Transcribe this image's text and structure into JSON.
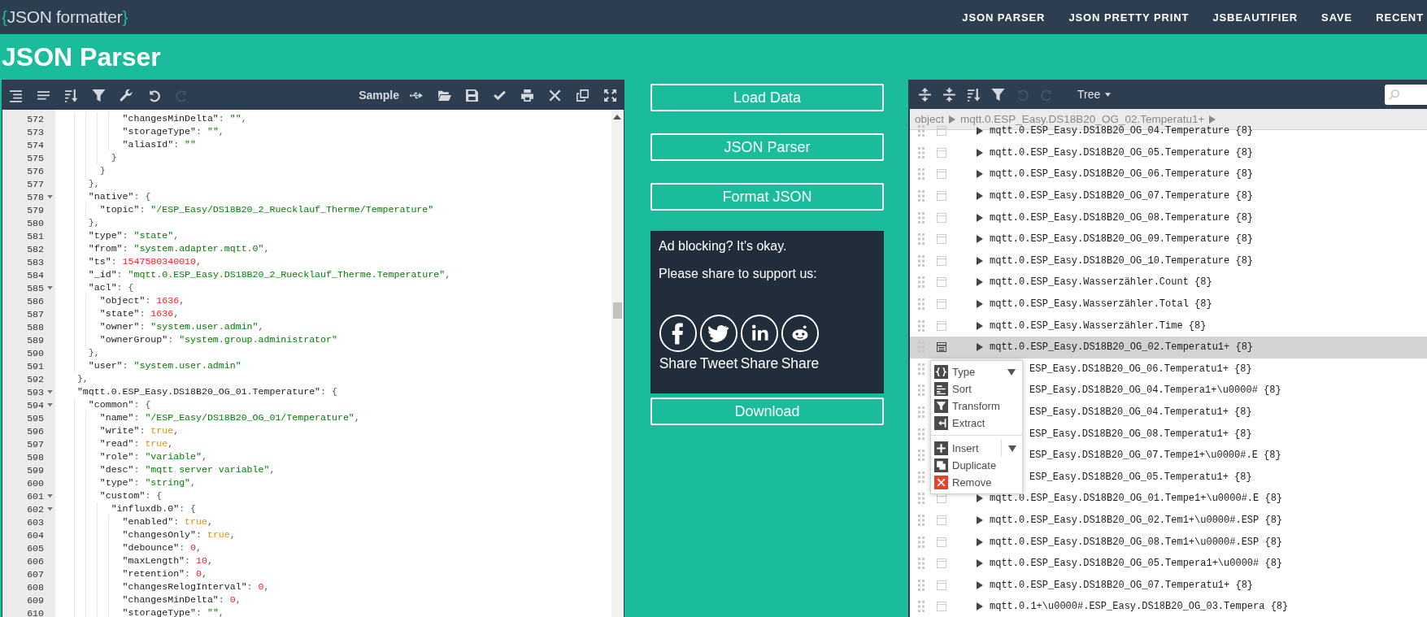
{
  "nav": {
    "logo": {
      "open": "{",
      "name": "JSON formatter",
      "close": "}"
    },
    "links": [
      "JSON PARSER",
      "JSON PRETTY PRINT",
      "JSBEAUTIFIER",
      "SAVE",
      "RECENT"
    ]
  },
  "page_title": "JSON Parser",
  "code_editor": {
    "tools": [
      {
        "kind": "format",
        "disabled": false
      },
      {
        "kind": "compact",
        "disabled": false
      },
      {
        "kind": "sort",
        "disabled": false
      },
      {
        "kind": "filter",
        "disabled": false
      },
      {
        "kind": "repair",
        "disabled": false
      },
      {
        "kind": "undo",
        "disabled": false
      },
      {
        "kind": "redo",
        "disabled": true
      }
    ],
    "sample_button": "Sample",
    "file_tools": [
      {
        "kind": "usb"
      },
      {
        "kind": "open"
      },
      {
        "kind": "save"
      },
      {
        "kind": "validate"
      },
      {
        "kind": "print"
      },
      {
        "kind": "clear"
      },
      {
        "kind": "copy"
      },
      {
        "kind": "fullscreen"
      }
    ],
    "lines": [
      {
        "number": "572",
        "fold": false,
        "tokens": [
          {
            "kind": "key",
            "text": "          \"changesMinDelta\""
          },
          {
            "kind": "punct",
            "text": ": "
          },
          {
            "kind": "str",
            "text": "\"\""
          },
          {
            "kind": "punct",
            "text": ","
          }
        ]
      },
      {
        "number": "573",
        "fold": false,
        "tokens": [
          {
            "kind": "key",
            "text": "          \"storageType\""
          },
          {
            "kind": "punct",
            "text": ": "
          },
          {
            "kind": "str",
            "text": "\"\""
          },
          {
            "kind": "punct",
            "text": ","
          }
        ]
      },
      {
        "number": "574",
        "fold": false,
        "tokens": [
          {
            "kind": "key",
            "text": "          \"aliasId\""
          },
          {
            "kind": "punct",
            "text": ": "
          },
          {
            "kind": "str",
            "text": "\"\""
          }
        ]
      },
      {
        "number": "575",
        "fold": false,
        "tokens": [
          {
            "kind": "punct",
            "text": "        }"
          }
        ]
      },
      {
        "number": "576",
        "fold": false,
        "tokens": [
          {
            "kind": "punct",
            "text": "      }"
          }
        ]
      },
      {
        "number": "577",
        "fold": false,
        "tokens": [
          {
            "kind": "punct",
            "text": "    },"
          }
        ]
      },
      {
        "number": "578",
        "fold": true,
        "tokens": [
          {
            "kind": "key",
            "text": "    \"native\""
          },
          {
            "kind": "punct",
            "text": ": {"
          }
        ]
      },
      {
        "number": "579",
        "fold": false,
        "tokens": [
          {
            "kind": "key",
            "text": "      \"topic\""
          },
          {
            "kind": "punct",
            "text": ": "
          },
          {
            "kind": "str",
            "text": "\"/ESP_Easy/DS18B20_2_Ruecklauf_Therme/Temperature\""
          }
        ]
      },
      {
        "number": "580",
        "fold": false,
        "tokens": [
          {
            "kind": "punct",
            "text": "    },"
          }
        ]
      },
      {
        "number": "581",
        "fold": false,
        "tokens": [
          {
            "kind": "key",
            "text": "    \"type\""
          },
          {
            "kind": "punct",
            "text": ": "
          },
          {
            "kind": "str",
            "text": "\"state\""
          },
          {
            "kind": "punct",
            "text": ","
          }
        ]
      },
      {
        "number": "582",
        "fold": false,
        "tokens": [
          {
            "kind": "key",
            "text": "    \"from\""
          },
          {
            "kind": "punct",
            "text": ": "
          },
          {
            "kind": "str",
            "text": "\"system.adapter.mqtt.0\""
          },
          {
            "kind": "punct",
            "text": ","
          }
        ]
      },
      {
        "number": "583",
        "fold": false,
        "tokens": [
          {
            "kind": "key",
            "text": "    \"ts\""
          },
          {
            "kind": "punct",
            "text": ": "
          },
          {
            "kind": "num",
            "text": "1547580340010"
          },
          {
            "kind": "punct",
            "text": ","
          }
        ]
      },
      {
        "number": "584",
        "fold": false,
        "tokens": [
          {
            "kind": "key",
            "text": "    \"_id\""
          },
          {
            "kind": "punct",
            "text": ": "
          },
          {
            "kind": "str",
            "text": "\"mqtt.0.ESP_Easy.DS18B20_2_Ruecklauf_Therme.Temperature\""
          },
          {
            "kind": "punct",
            "text": ","
          }
        ]
      },
      {
        "number": "585",
        "fold": true,
        "tokens": [
          {
            "kind": "key",
            "text": "    \"acl\""
          },
          {
            "kind": "punct",
            "text": ": {"
          }
        ]
      },
      {
        "number": "586",
        "fold": false,
        "tokens": [
          {
            "kind": "key",
            "text": "      \"object\""
          },
          {
            "kind": "punct",
            "text": ": "
          },
          {
            "kind": "num",
            "text": "1636"
          },
          {
            "kind": "punct",
            "text": ","
          }
        ]
      },
      {
        "number": "587",
        "fold": false,
        "tokens": [
          {
            "kind": "key",
            "text": "      \"state\""
          },
          {
            "kind": "punct",
            "text": ": "
          },
          {
            "kind": "num",
            "text": "1636"
          },
          {
            "kind": "punct",
            "text": ","
          }
        ]
      },
      {
        "number": "588",
        "fold": false,
        "tokens": [
          {
            "kind": "key",
            "text": "      \"owner\""
          },
          {
            "kind": "punct",
            "text": ": "
          },
          {
            "kind": "str",
            "text": "\"system.user.admin\""
          },
          {
            "kind": "punct",
            "text": ","
          }
        ]
      },
      {
        "number": "589",
        "fold": false,
        "tokens": [
          {
            "kind": "key",
            "text": "      \"ownerGroup\""
          },
          {
            "kind": "punct",
            "text": ": "
          },
          {
            "kind": "str",
            "text": "\"system.group.administrator\""
          }
        ]
      },
      {
        "number": "590",
        "fold": false,
        "tokens": [
          {
            "kind": "punct",
            "text": "    },"
          }
        ]
      },
      {
        "number": "591",
        "fold": false,
        "tokens": [
          {
            "kind": "key",
            "text": "    \"user\""
          },
          {
            "kind": "punct",
            "text": ": "
          },
          {
            "kind": "str",
            "text": "\"system.user.admin\""
          }
        ]
      },
      {
        "number": "592",
        "fold": false,
        "tokens": [
          {
            "kind": "punct",
            "text": "  },"
          }
        ]
      },
      {
        "number": "593",
        "fold": true,
        "tokens": [
          {
            "kind": "key",
            "text": "  \"mqtt.0.ESP_Easy.DS18B20_OG_01.Temperature\""
          },
          {
            "kind": "punct",
            "text": ": {"
          }
        ]
      },
      {
        "number": "594",
        "fold": true,
        "tokens": [
          {
            "kind": "key",
            "text": "    \"common\""
          },
          {
            "kind": "punct",
            "text": ": {"
          }
        ]
      },
      {
        "number": "595",
        "fold": false,
        "tokens": [
          {
            "kind": "key",
            "text": "      \"name\""
          },
          {
            "kind": "punct",
            "text": ": "
          },
          {
            "kind": "str",
            "text": "\"/ESP_Easy/DS18B20_OG_01/Temperature\""
          },
          {
            "kind": "punct",
            "text": ","
          }
        ]
      },
      {
        "number": "596",
        "fold": false,
        "tokens": [
          {
            "kind": "key",
            "text": "      \"write\""
          },
          {
            "kind": "punct",
            "text": ": "
          },
          {
            "kind": "bool",
            "text": "true"
          },
          {
            "kind": "punct",
            "text": ","
          }
        ]
      },
      {
        "number": "597",
        "fold": false,
        "tokens": [
          {
            "kind": "key",
            "text": "      \"read\""
          },
          {
            "kind": "punct",
            "text": ": "
          },
          {
            "kind": "bool",
            "text": "true"
          },
          {
            "kind": "punct",
            "text": ","
          }
        ]
      },
      {
        "number": "598",
        "fold": false,
        "tokens": [
          {
            "kind": "key",
            "text": "      \"role\""
          },
          {
            "kind": "punct",
            "text": ": "
          },
          {
            "kind": "str",
            "text": "\"variable\""
          },
          {
            "kind": "punct",
            "text": ","
          }
        ]
      },
      {
        "number": "599",
        "fold": false,
        "tokens": [
          {
            "kind": "key",
            "text": "      \"desc\""
          },
          {
            "kind": "punct",
            "text": ": "
          },
          {
            "kind": "str",
            "text": "\"mqtt server variable\""
          },
          {
            "kind": "punct",
            "text": ","
          }
        ]
      },
      {
        "number": "600",
        "fold": false,
        "tokens": [
          {
            "kind": "key",
            "text": "      \"type\""
          },
          {
            "kind": "punct",
            "text": ": "
          },
          {
            "kind": "str",
            "text": "\"string\""
          },
          {
            "kind": "punct",
            "text": ","
          }
        ]
      },
      {
        "number": "601",
        "fold": true,
        "tokens": [
          {
            "kind": "key",
            "text": "      \"custom\""
          },
          {
            "kind": "punct",
            "text": ": {"
          }
        ]
      },
      {
        "number": "602",
        "fold": true,
        "tokens": [
          {
            "kind": "key",
            "text": "        \"influxdb.0\""
          },
          {
            "kind": "punct",
            "text": ": {"
          }
        ]
      },
      {
        "number": "603",
        "fold": false,
        "tokens": [
          {
            "kind": "key",
            "text": "          \"enabled\""
          },
          {
            "kind": "punct",
            "text": ": "
          },
          {
            "kind": "bool",
            "text": "true"
          },
          {
            "kind": "punct",
            "text": ","
          }
        ]
      },
      {
        "number": "604",
        "fold": false,
        "tokens": [
          {
            "kind": "key",
            "text": "          \"changesOnly\""
          },
          {
            "kind": "punct",
            "text": ": "
          },
          {
            "kind": "bool",
            "text": "true"
          },
          {
            "kind": "punct",
            "text": ","
          }
        ]
      },
      {
        "number": "605",
        "fold": false,
        "tokens": [
          {
            "kind": "key",
            "text": "          \"debounce\""
          },
          {
            "kind": "punct",
            "text": ": "
          },
          {
            "kind": "num",
            "text": "0"
          },
          {
            "kind": "punct",
            "text": ","
          }
        ]
      },
      {
        "number": "606",
        "fold": false,
        "tokens": [
          {
            "kind": "key",
            "text": "          \"maxLength\""
          },
          {
            "kind": "punct",
            "text": ": "
          },
          {
            "kind": "num",
            "text": "10"
          },
          {
            "kind": "punct",
            "text": ","
          }
        ]
      },
      {
        "number": "607",
        "fold": false,
        "tokens": [
          {
            "kind": "key",
            "text": "          \"retention\""
          },
          {
            "kind": "punct",
            "text": ": "
          },
          {
            "kind": "num",
            "text": "0"
          },
          {
            "kind": "punct",
            "text": ","
          }
        ]
      },
      {
        "number": "608",
        "fold": false,
        "tokens": [
          {
            "kind": "key",
            "text": "          \"changesRelogInterval\""
          },
          {
            "kind": "punct",
            "text": ": "
          },
          {
            "kind": "num",
            "text": "0"
          },
          {
            "kind": "punct",
            "text": ","
          }
        ]
      },
      {
        "number": "609",
        "fold": false,
        "tokens": [
          {
            "kind": "key",
            "text": "          \"changesMinDelta\""
          },
          {
            "kind": "punct",
            "text": ": "
          },
          {
            "kind": "num",
            "text": "0"
          },
          {
            "kind": "punct",
            "text": ","
          }
        ]
      },
      {
        "number": "610",
        "fold": false,
        "tokens": [
          {
            "kind": "key",
            "text": "          \"storageType\""
          },
          {
            "kind": "punct",
            "text": ": "
          },
          {
            "kind": "str",
            "text": "\"\""
          },
          {
            "kind": "punct",
            "text": ","
          }
        ]
      }
    ]
  },
  "actions": {
    "buttons": [
      "Load Data",
      "JSON Parser",
      "Format JSON"
    ],
    "download": "Download"
  },
  "ad": {
    "lines": [
      "Ad blocking? It's okay.",
      "Please share to support us:"
    ],
    "shares": [
      {
        "kind": "f",
        "label": "Share"
      },
      {
        "kind": "bird",
        "label": "Tweet"
      },
      {
        "kind": "in",
        "label": "Share"
      },
      {
        "kind": "alien",
        "label": "Share"
      }
    ]
  },
  "tree_view": {
    "tools": [
      {
        "kind": "expand_all",
        "disabled": false
      },
      {
        "kind": "collapse_all",
        "disabled": false
      },
      {
        "kind": "sort",
        "disabled": false
      },
      {
        "kind": "filter",
        "disabled": false
      },
      {
        "kind": "undo",
        "disabled": true
      },
      {
        "kind": "redo",
        "disabled": true
      }
    ],
    "mode": "Tree",
    "breadcrumb": [
      "object",
      "mqtt.0.ESP_Easy.DS18B20_OG_02.Temperatu1+"
    ],
    "rows": [
      {
        "text": "mqtt.0.ESP_Easy.DS18B20_OG_04.Temperature",
        "count": "{8}",
        "selected": false,
        "covered": false
      },
      {
        "text": "mqtt.0.ESP_Easy.DS18B20_OG_05.Temperature",
        "count": "{8}",
        "selected": false,
        "covered": false
      },
      {
        "text": "mqtt.0.ESP_Easy.DS18B20_OG_06.Temperature",
        "count": "{8}",
        "selected": false,
        "covered": false
      },
      {
        "text": "mqtt.0.ESP_Easy.DS18B20_OG_07.Temperature",
        "count": "{8}",
        "selected": false,
        "covered": false
      },
      {
        "text": "mqtt.0.ESP_Easy.DS18B20_OG_08.Temperature",
        "count": "{8}",
        "selected": false,
        "covered": false
      },
      {
        "text": "mqtt.0.ESP_Easy.DS18B20_OG_09.Temperature",
        "count": "{8}",
        "selected": false,
        "covered": false
      },
      {
        "text": "mqtt.0.ESP_Easy.DS18B20_OG_10.Temperature",
        "count": "{8}",
        "selected": false,
        "covered": false
      },
      {
        "text": "mqtt.0.ESP_Easy.Wasserzähler.Count",
        "count": "{8}",
        "selected": false,
        "covered": false
      },
      {
        "text": "mqtt.0.ESP_Easy.Wasserzähler.Total",
        "count": "{8}",
        "selected": false,
        "covered": false
      },
      {
        "text": "mqtt.0.ESP_Easy.Wasserzähler.Time",
        "count": "{8}",
        "selected": false,
        "covered": false
      },
      {
        "text": "mqtt.0.ESP_Easy.DS18B20_OG_02.Temperatu1+",
        "count": "{8}",
        "selected": true,
        "covered": false
      },
      {
        "text": "ESP_Easy.DS18B20_OG_06.Temperatu1+",
        "count": "{8}",
        "selected": false,
        "covered": true
      },
      {
        "text": "ESP_Easy.DS18B20_OG_04.Tempera1+\\u0000#",
        "count": "{8}",
        "selected": false,
        "covered": true
      },
      {
        "text": "ESP_Easy.DS18B20_OG_04.Temperatu1+",
        "count": "{8}",
        "selected": false,
        "covered": true
      },
      {
        "text": "ESP_Easy.DS18B20_OG_08.Temperatu1+",
        "count": "{8}",
        "selected": false,
        "covered": true
      },
      {
        "text": "ESP_Easy.DS18B20_OG_07.Tempe1+\\u0000#.E",
        "count": "{8}",
        "selected": false,
        "covered": true
      },
      {
        "text": "ESP_Easy.DS18B20_OG_05.Temperatu1+",
        "count": "{8}",
        "selected": false,
        "covered": true
      },
      {
        "text": "mqtt.0.ESP_Easy.DS18B20_OG_01.Tempe1+\\u0000#.E",
        "count": "{8}",
        "selected": false,
        "covered": false
      },
      {
        "text": "mqtt.0.ESP_Easy.DS18B20_OG_02.Tem1+\\u0000#.ESP",
        "count": "{8}",
        "selected": false,
        "covered": false
      },
      {
        "text": "mqtt.0.ESP_Easy.DS18B20_OG_08.Tem1+\\u0000#.ESP",
        "count": "{8}",
        "selected": false,
        "covered": false
      },
      {
        "text": "mqtt.0.ESP_Easy.DS18B20_OG_05.Tempera1+\\u0000#",
        "count": "{8}",
        "selected": false,
        "covered": false
      },
      {
        "text": "mqtt.0.ESP_Easy.DS18B20_OG_07.Temperatu1+",
        "count": "{8}",
        "selected": false,
        "covered": false
      },
      {
        "text": "mqtt.0.1+\\u0000#.ESP_Easy.DS18B20_OG_03.Tempera",
        "count": "{8}",
        "selected": false,
        "covered": false
      }
    ],
    "context_menu": {
      "groups": [
        [
          {
            "kind": "type",
            "label": "Type",
            "submenu": true,
            "split": false
          },
          {
            "kind": "sort",
            "label": "Sort",
            "submenu": false
          },
          {
            "kind": "transform",
            "label": "Transform",
            "submenu": false
          },
          {
            "kind": "extract",
            "label": "Extract",
            "submenu": false
          }
        ],
        [
          {
            "kind": "insert",
            "label": "Insert",
            "submenu": true,
            "split": true
          },
          {
            "kind": "duplicate",
            "label": "Duplicate",
            "submenu": false
          },
          {
            "kind": "remove",
            "label": "Remove",
            "submenu": false
          }
        ]
      ]
    }
  }
}
